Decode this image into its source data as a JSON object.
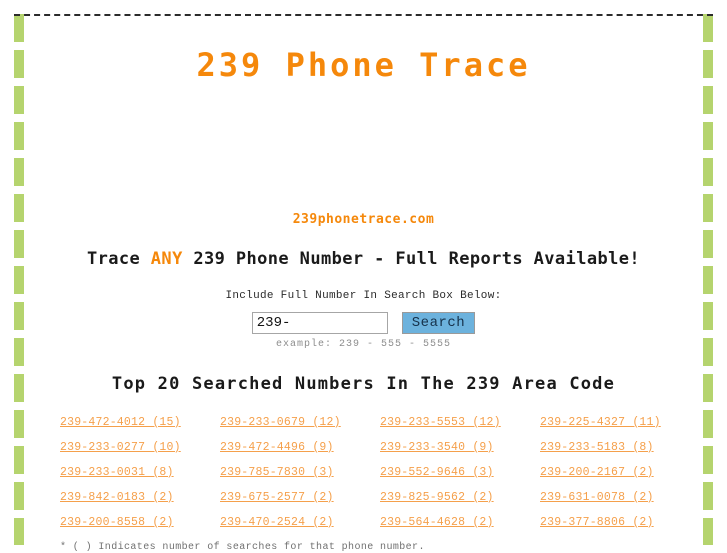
{
  "site": {
    "title": "239 Phone Trace",
    "domain": "239phonetrace.com",
    "tagline_before": "Trace ",
    "tagline_highlight": "ANY",
    "tagline_after": " 239 Phone Number - Full Reports Available!"
  },
  "search": {
    "label": "Include Full Number In Search Box Below:",
    "value": "239-",
    "placeholder": "239-",
    "button_label": "Search",
    "example": "example: 239 - 555 - 5555"
  },
  "top_list": {
    "heading": "Top 20 Searched Numbers In The 239 Area Code",
    "footnote": "* ( ) Indicates number of searches for that phone number.",
    "items": [
      {
        "number": "239-472-4012",
        "count": "(15)",
        "label": "239-472-4012  (15)"
      },
      {
        "number": "239-233-0679",
        "count": "(12)",
        "label": "239-233-0679  (12)"
      },
      {
        "number": "239-233-5553",
        "count": "(12)",
        "label": "239-233-5553  (12)"
      },
      {
        "number": "239-225-4327",
        "count": "(11)",
        "label": "239-225-4327  (11)"
      },
      {
        "number": "239-233-0277",
        "count": "(10)",
        "label": "239-233-0277  (10)"
      },
      {
        "number": "239-472-4496",
        "count": "(9)",
        "label": "239-472-4496  (9)"
      },
      {
        "number": "239-233-3540",
        "count": "(9)",
        "label": "239-233-3540  (9)"
      },
      {
        "number": "239-233-5183",
        "count": "(8)",
        "label": "239-233-5183  (8)"
      },
      {
        "number": "239-233-0031",
        "count": "(8)",
        "label": "239-233-0031  (8)"
      },
      {
        "number": "239-785-7830",
        "count": "(3)",
        "label": "239-785-7830  (3)"
      },
      {
        "number": "239-552-9646",
        "count": "(3)",
        "label": "239-552-9646  (3)"
      },
      {
        "number": "239-200-2167",
        "count": "(2)",
        "label": "239-200-2167  (2)"
      },
      {
        "number": "239-842-0183",
        "count": "(2)",
        "label": "239-842-0183  (2)"
      },
      {
        "number": "239-675-2577",
        "count": "(2)",
        "label": "239-675-2577  (2)"
      },
      {
        "number": "239-825-9562",
        "count": "(2)",
        "label": "239-825-9562  (2)"
      },
      {
        "number": "239-631-0078",
        "count": "(2)",
        "label": "239-631-0078  (2)"
      },
      {
        "number": "239-200-8558",
        "count": "(2)",
        "label": "239-200-8558  (2)"
      },
      {
        "number": "239-470-2524",
        "count": "(2)",
        "label": "239-470-2524  (2)"
      },
      {
        "number": "239-564-4628",
        "count": "(2)",
        "label": "239-564-4628  (2)"
      },
      {
        "number": "239-377-8806",
        "count": "(2)",
        "label": "239-377-8806  (2)"
      }
    ]
  },
  "colors": {
    "accent_orange": "#f5880b",
    "link_orange": "#f5a04b",
    "rail_green": "#b5d46e",
    "button_blue": "#6cb2dd",
    "text_dark": "#1a1a1a",
    "muted_gray": "#8d8d8d"
  }
}
